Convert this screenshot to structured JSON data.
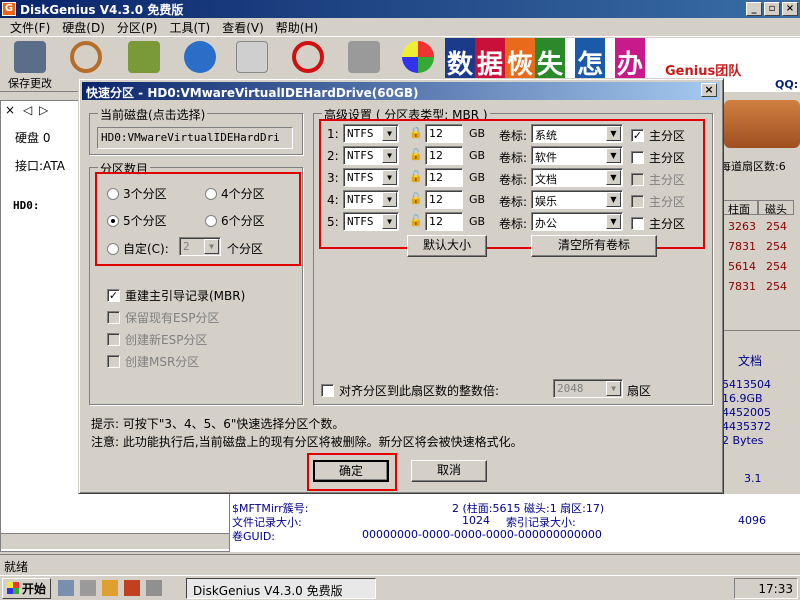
{
  "app": {
    "title": "DiskGenius V4.3.0 免费版",
    "menu": [
      "文件(F)",
      "硬盘(D)",
      "分区(P)",
      "工具(T)",
      "查看(V)",
      "帮助(H)"
    ],
    "toolbar_first": "保存更改",
    "status": "就绪"
  },
  "banner": {
    "chars": [
      "数",
      "据",
      "恢",
      "失",
      "怎",
      "办"
    ],
    "text": "Genius团队",
    "qq": "QQ:"
  },
  "left": {
    "disk_label": "硬盘 0",
    "iface_label": "接口:ATA",
    "tree_root": "HD0:"
  },
  "right": {
    "header_label": "每道扇区数:6",
    "col_headers": [
      "柱面",
      "磁头"
    ],
    "rows": [
      [
        "3263",
        "254"
      ],
      [
        "7831",
        "254"
      ],
      [
        "5614",
        "254"
      ],
      [
        "7831",
        "254"
      ]
    ],
    "doc_label": "文档",
    "info": [
      "5413504",
      "16.9GB",
      "4452005",
      "4435372",
      "2 Bytes",
      "3.1"
    ]
  },
  "bottom_info": [
    {
      "label": "$MFTMirr簇号:",
      "value": "2 (柱面:5615 磁头:1 扇区:17)"
    },
    {
      "label": "文件记录大小:",
      "value": "1024",
      "label2": "索引记录大小:",
      "value2": "4096"
    },
    {
      "label": "卷GUID:",
      "value": "00000000-0000-0000-0000-000000000000"
    }
  ],
  "dialog": {
    "title": "快速分区 - HD0:VMwareVirtualIDEHardDrive(60GB)",
    "current_disk_label": "当前磁盘(点击选择)",
    "current_disk_value": "HD0:VMwareVirtualIDEHardDri",
    "count_group_label": "分区数目",
    "count_options": [
      "3个分区",
      "4个分区",
      "5个分区",
      "6个分区"
    ],
    "count_selected": "5个分区",
    "custom_label": "自定(C):",
    "custom_value": "2",
    "custom_suffix": "个分区",
    "rebuild_mbr": "重建主引导记录(MBR)",
    "keep_esp": "保留现有ESP分区",
    "create_esp": "创建新ESP分区",
    "create_msr": "创建MSR分区",
    "advanced_label": "高级设置 ( 分区表类型: MBR )",
    "size_unit": "GB",
    "vol_label": "卷标:",
    "primary_label": "主分区",
    "partitions": [
      {
        "idx": "1:",
        "fs": "NTFS",
        "size": "12",
        "name": "系统",
        "primary": true
      },
      {
        "idx": "2:",
        "fs": "NTFS",
        "size": "12",
        "name": "软件",
        "primary": false
      },
      {
        "idx": "3:",
        "fs": "NTFS",
        "size": "12",
        "name": "文档",
        "primary": false
      },
      {
        "idx": "4:",
        "fs": "NTFS",
        "size": "12",
        "name": "娱乐",
        "primary": false
      },
      {
        "idx": "5:",
        "fs": "NTFS",
        "size": "12",
        "name": "办公",
        "primary": false
      }
    ],
    "default_size_btn": "默认大小",
    "clear_labels_btn": "清空所有卷标",
    "align_label": "对齐分区到此扇区数的整数倍:",
    "align_value": "2048",
    "align_unit": "扇区",
    "hint": "提示: 可按下\"3、4、5、6\"快速选择分区个数。",
    "note": "注意: 此功能执行后,当前磁盘上的现有分区将被删除。新分区将会被快速格式化。",
    "ok": "确定",
    "cancel": "取消"
  },
  "taskbar": {
    "start": "开始",
    "item": "DiskGenius V4.3.0 免费版",
    "time": "17:33"
  },
  "colors": {
    "title": "#0a246a",
    "highlight": "#e00000",
    "gridtext": "#8b0000"
  }
}
